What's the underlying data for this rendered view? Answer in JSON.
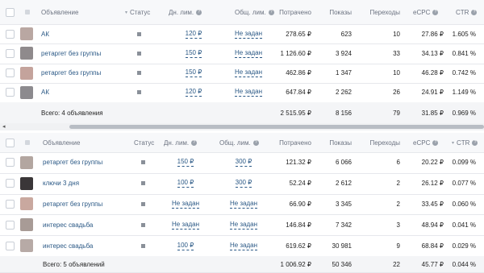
{
  "table1": {
    "headers": {
      "name": "Объявление",
      "status": "Статус",
      "day_limit": "Дн. лим.",
      "total_limit": "Общ. лим.",
      "spent": "Потрачено",
      "shows": "Показы",
      "clicks": "Переходы",
      "ecpc": "eCPC",
      "ctr": "CTR"
    },
    "rows": [
      {
        "name": "АК",
        "day_limit": "120 ₽",
        "total_limit": "Не задан",
        "spent": "278.65 ₽",
        "shows": "623",
        "clicks": "10",
        "ecpc": "27.86 ₽",
        "ctr": "1.605 %",
        "thumb": "#b9a7a2"
      },
      {
        "name": "ретаргет без группы",
        "day_limit": "150 ₽",
        "total_limit": "Не задан",
        "spent": "1 126.60 ₽",
        "shows": "3 924",
        "clicks": "33",
        "ecpc": "34.13 ₽",
        "ctr": "0.841 %",
        "thumb": "#8f8a8c"
      },
      {
        "name": "ретаргет без группы",
        "day_limit": "150 ₽",
        "total_limit": "Не задан",
        "spent": "462.86 ₽",
        "shows": "1 347",
        "clicks": "10",
        "ecpc": "46.28 ₽",
        "ctr": "0.742 %",
        "thumb": "#c4a39c"
      },
      {
        "name": "АК",
        "day_limit": "120 ₽",
        "total_limit": "Не задан",
        "spent": "647.84 ₽",
        "shows": "2 262",
        "clicks": "26",
        "ecpc": "24.91 ₽",
        "ctr": "1.149 %",
        "thumb": "#8c8a8e"
      }
    ],
    "total": {
      "label": "Всего: 4 объявления",
      "spent": "2 515.95 ₽",
      "shows": "8 156",
      "clicks": "79",
      "ecpc": "31.85 ₽",
      "ctr": "0.969 %"
    }
  },
  "scrollbar": {
    "left_arrow": "◂"
  },
  "table2": {
    "headers": {
      "name": "Объявление",
      "status": "Статус",
      "day_limit": "Дн. лим.",
      "total_limit": "Общ. лим.",
      "spent": "Потрачено",
      "shows": "Показы",
      "clicks": "Переходы",
      "ecpc": "eCPC",
      "ctr": "CTR"
    },
    "rows": [
      {
        "name": "ретаргет без группы",
        "day_limit": "150 ₽",
        "total_limit": "300 ₽",
        "spent": "121.32 ₽",
        "shows": "6 066",
        "clicks": "6",
        "ecpc": "20.22 ₽",
        "ctr": "0.099 %",
        "thumb": "#b3a6a0"
      },
      {
        "name": "ключи 3 дня",
        "day_limit": "100 ₽",
        "total_limit": "300 ₽",
        "spent": "52.24 ₽",
        "shows": "2 612",
        "clicks": "2",
        "ecpc": "26.12 ₽",
        "ctr": "0.077 %",
        "thumb": "#3a3638"
      },
      {
        "name": "ретаргет без группы",
        "day_limit": "Не задан",
        "total_limit": "Не задан",
        "spent": "66.90 ₽",
        "shows": "3 345",
        "clicks": "2",
        "ecpc": "33.45 ₽",
        "ctr": "0.060 %",
        "thumb": "#c9a89f"
      },
      {
        "name": "интерес свадьба",
        "day_limit": "Не задан",
        "total_limit": "Не задан",
        "spent": "146.84 ₽",
        "shows": "7 342",
        "clicks": "3",
        "ecpc": "48.94 ₽",
        "ctr": "0.041 %",
        "thumb": "#a89b96"
      },
      {
        "name": "интерес свадьба",
        "day_limit": "100 ₽",
        "total_limit": "Не задан",
        "spent": "619.62 ₽",
        "shows": "30 981",
        "clicks": "9",
        "ecpc": "68.84 ₽",
        "ctr": "0.029 %",
        "thumb": "#b7aaa6"
      }
    ],
    "total": {
      "label": "Всего: 5 объявлений",
      "spent": "1 006.92 ₽",
      "shows": "50 346",
      "clicks": "22",
      "ecpc": "45.77 ₽",
      "ctr": "0.044 %"
    }
  },
  "icons": {
    "help": "?",
    "sort_arrow": "▾",
    "sort_arrow_ctr": "▾"
  }
}
